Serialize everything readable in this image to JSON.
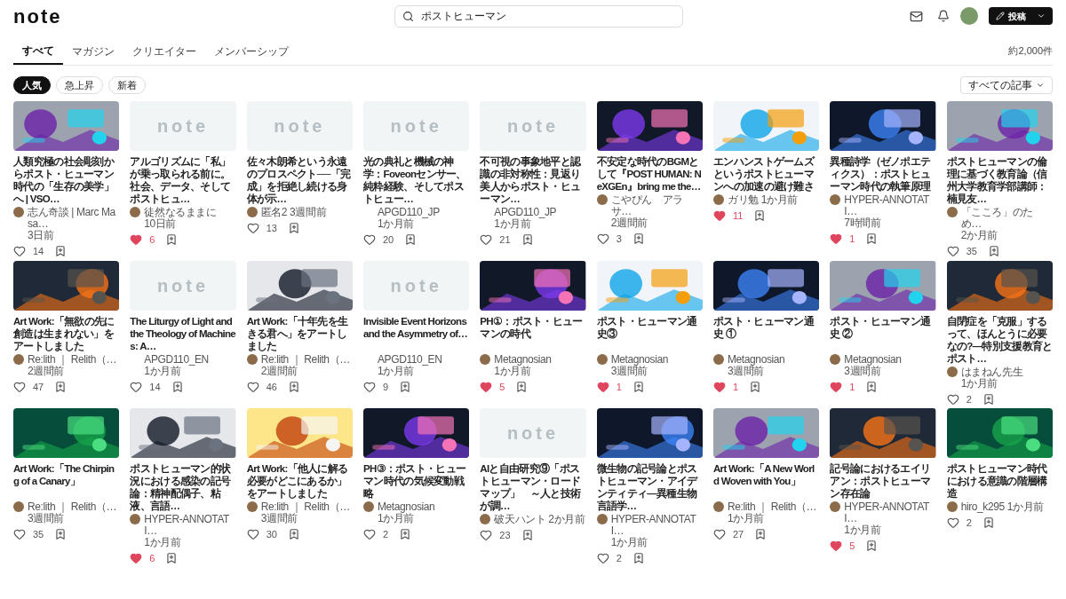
{
  "header": {
    "logo": "note",
    "search": {
      "value": "ポストヒューマン"
    },
    "post_button": "投稿"
  },
  "tabs": [
    {
      "label": "すべて",
      "selected": true
    },
    {
      "label": "マガジン",
      "selected": false
    },
    {
      "label": "クリエイター",
      "selected": false
    },
    {
      "label": "メンバーシップ",
      "selected": false
    }
  ],
  "result_count": "約2,000件",
  "filters": [
    {
      "label": "人気",
      "selected": true
    },
    {
      "label": "急上昇",
      "selected": false
    },
    {
      "label": "新着",
      "selected": false
    }
  ],
  "sort_dropdown": "すべての記事",
  "articles": [
    {
      "kind": "picture",
      "title": "人類究極の社会彫刻からポスト・ヒューマン時代の「生存の美学」へ | VSO…",
      "author": "志ん奇談 | Marc Masa…",
      "avatar": true,
      "time": "3日前",
      "likes": "14",
      "liked": false
    },
    {
      "kind": "placeholder",
      "placeholder_text": "note",
      "title": "アルゴリズムに「私」が乗っ取られる前に。社会、データ、そしてポストヒュ…",
      "author": "徒然なるままに",
      "avatar": true,
      "time": "10日前",
      "likes": "6",
      "liked": true
    },
    {
      "kind": "placeholder",
      "placeholder_text": "note",
      "title": "佐々木朗希という永遠のプロスペクト──「完成」を拒絶し続ける身体が示…",
      "author": "匿名2",
      "avatar": true,
      "time": "3週間前",
      "likes": "13",
      "liked": false
    },
    {
      "kind": "placeholder",
      "placeholder_text": "note",
      "title": "光の典礼と機械の神学：Foveonセンサー、純粋経験、そしてポストヒュー…",
      "author": "APGD110_JP",
      "avatar": false,
      "time": "1か月前",
      "likes": "20",
      "liked": false
    },
    {
      "kind": "placeholder",
      "placeholder_text": "note",
      "title": "不可視の事象地平と認識の非対称性：見返り美人からポスト・ヒューマン…",
      "author": "APGD110_JP",
      "avatar": false,
      "time": "1か月前",
      "likes": "21",
      "liked": false
    },
    {
      "kind": "picture",
      "title": "不安定な時代のBGMとして『POST HUMAN: NeXGEn』bring me the…",
      "author": "こやぴん　アラサ…",
      "avatar": true,
      "time": "2週間前",
      "likes": "3",
      "liked": false
    },
    {
      "kind": "picture",
      "title": "エンハンストゲームズというポストヒューマンへの加速の避け難さ",
      "author": "ガリ勉",
      "avatar": true,
      "time": "1か月前",
      "likes": "11",
      "liked": true
    },
    {
      "kind": "picture",
      "title": "異種詩学（ゼノポエティクス）：ポストヒューマン時代の執筆原理",
      "author": "HYPER-ANNOTATI…",
      "avatar": true,
      "time": "7時間前",
      "likes": "1",
      "liked": true
    },
    {
      "kind": "picture",
      "title": "ポストヒューマンの倫理に基づく教育論（信州大学教育学部講師：楠見友…",
      "author": "「こころ」のため…",
      "avatar": true,
      "time": "2か月前",
      "likes": "35",
      "liked": false
    },
    {
      "kind": "picture",
      "title": "Art Work:「無欲の先に創造は生まれない」をアートしました",
      "author": "Re:lith ｜ Relith（…",
      "avatar": true,
      "time": "2週間前",
      "likes": "47",
      "liked": false
    },
    {
      "kind": "placeholder",
      "placeholder_text": "note",
      "title": "The Liturgy of Light and the Theology of Machines: A…",
      "author": "APGD110_EN",
      "avatar": false,
      "time": "1か月前",
      "likes": "14",
      "liked": false
    },
    {
      "kind": "picture",
      "title": "Art Work:「十年先を生きる君へ」をアートしました",
      "author": "Re:lith ｜ Relith（…",
      "avatar": true,
      "time": "2週間前",
      "likes": "46",
      "liked": false
    },
    {
      "kind": "placeholder",
      "placeholder_text": "note",
      "title": "Invisible Event Horizons and the Asymmetry of…",
      "author": "APGD110_EN",
      "avatar": false,
      "time": "1か月前",
      "likes": "9",
      "liked": false
    },
    {
      "kind": "picture",
      "title": "PH①：ポスト・ヒューマンの時代",
      "author": "Metagnosian",
      "avatar": true,
      "time": "1か月前",
      "likes": "5",
      "liked": true
    },
    {
      "kind": "picture",
      "title": "ポスト・ヒューマン通史③",
      "author": "Metagnosian",
      "avatar": true,
      "time": "3週間前",
      "likes": "1",
      "liked": true
    },
    {
      "kind": "picture",
      "title": "ポスト・ヒューマン通史 ①",
      "author": "Metagnosian",
      "avatar": true,
      "time": "3週間前",
      "likes": "1",
      "liked": true
    },
    {
      "kind": "picture",
      "title": "ポスト・ヒューマン通史 ②",
      "author": "Metagnosian",
      "avatar": true,
      "time": "3週間前",
      "likes": "1",
      "liked": true
    },
    {
      "kind": "picture",
      "title": "自閉症を「克服」するって、ほんとうに必要なの?―特別支援教育とポスト…",
      "author": "はまねん先生",
      "avatar": true,
      "time": "1か月前",
      "likes": "2",
      "liked": false
    },
    {
      "kind": "picture",
      "title": "Art Work:「The Chirping of a Canary」",
      "author": "Re:lith ｜ Relith（…",
      "avatar": true,
      "time": "3週間前",
      "likes": "35",
      "liked": false
    },
    {
      "kind": "picture",
      "title": "ポストヒューマン的状況における感染の記号論：精神配偶子、粘液、言語…",
      "author": "HYPER-ANNOTATI…",
      "avatar": true,
      "time": "1か月前",
      "likes": "6",
      "liked": true
    },
    {
      "kind": "picture",
      "title": "Art Work:「他人に解る必要がどこにあるか」をアートしました",
      "author": "Re:lith ｜ Relith（…",
      "avatar": true,
      "time": "3週間前",
      "likes": "30",
      "liked": false
    },
    {
      "kind": "picture",
      "title": "PH③：ポスト・ヒューマン時代の気候変動戦略",
      "author": "Metagnosian",
      "avatar": true,
      "time": "1か月前",
      "likes": "2",
      "liked": false
    },
    {
      "kind": "placeholder",
      "placeholder_text": "note",
      "title": "AIと自由研究⑨「ポストヒューマン・ロードマップ」　～人と技術が調…",
      "author": "破天ハント",
      "avatar": true,
      "time": "2か月前",
      "likes": "23",
      "liked": false
    },
    {
      "kind": "picture",
      "title": "微生物の記号論とポストヒューマン・アイデンティティ―異種生物言語学…",
      "author": "HYPER-ANNOTATI…",
      "avatar": true,
      "time": "1か月前",
      "likes": "2",
      "liked": false
    },
    {
      "kind": "picture",
      "title": "Art Work:「A New World Woven with You」",
      "author": "Re:lith ｜ Relith（…",
      "avatar": true,
      "time": "1か月前",
      "likes": "27",
      "liked": false
    },
    {
      "kind": "picture",
      "title": "記号論におけるエイリアン：ポストヒューマン存在論",
      "author": "HYPER-ANNOTATI…",
      "avatar": true,
      "time": "1か月前",
      "likes": "5",
      "liked": true
    },
    {
      "kind": "picture",
      "title": "ポストヒューマン時代における意識の階層構造",
      "author": "hiro_k295",
      "avatar": true,
      "time": "1か月前",
      "likes": "2",
      "liked": false
    }
  ]
}
